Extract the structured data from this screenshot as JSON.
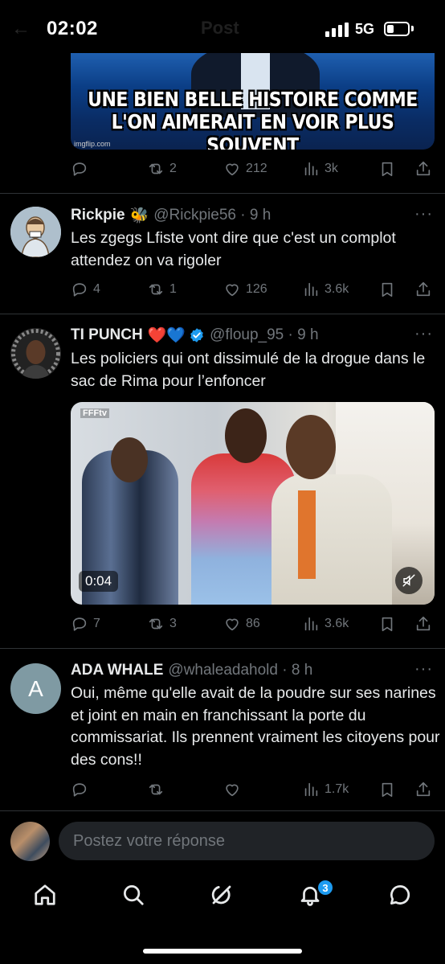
{
  "status_bar": {
    "time": "02:02",
    "network": "5G",
    "header_back": "←",
    "header_title": "Post"
  },
  "tweets": [
    {
      "image_caption_line1": "UNE BIEN BELLE HISTOIRE COMME",
      "image_caption_line2": "L'ON AIMERAIT EN VOIR PLUS SOUVENT",
      "image_watermark": "imgflip.com",
      "stats": {
        "replies": "",
        "reposts": "2",
        "likes": "212",
        "views": "3k"
      }
    },
    {
      "name": "Rickpie",
      "emoji": "🐝",
      "handle": "@Rickpie56 · 9 h",
      "text": "Les zgegs Lfiste vont dire que c'est un complot attendez on va rigoler",
      "stats": {
        "replies": "4",
        "reposts": "1",
        "likes": "126",
        "views": "3.6k"
      }
    },
    {
      "name": "TI PUNCH",
      "emoji": "❤️💙",
      "handle": "@floup_95 · 9 h",
      "text": "Les policiers qui ont dissimulé de la drogue dans le sac de Rima pour l’enfoncer",
      "video": {
        "channel_logo": "FFFtv",
        "duration": "0:04"
      },
      "stats": {
        "replies": "7",
        "reposts": "3",
        "likes": "86",
        "views": "3.6k"
      }
    },
    {
      "name": "ADA WHALE",
      "handle": "@whaleadahold · 8 h",
      "avatar_letter": "A",
      "text": "Oui, même qu'elle avait de la poudre sur ses narines et joint en main en franchissant la porte du commissariat. Ils prennent vraiment les citoyens pour des cons!!",
      "stats": {
        "replies": "",
        "reposts": "",
        "likes": "",
        "views": "1.7k"
      }
    }
  ],
  "reply": {
    "placeholder": "Postez votre réponse"
  },
  "nav": {
    "notifications_badge": "3"
  },
  "colors": {
    "background": "#000000",
    "text": "#e7e9ea",
    "muted": "#71767b",
    "accent": "#1d9bf0",
    "verified": "#1d9bf0",
    "input_bg": "#202327"
  },
  "icons": [
    "reply-icon",
    "repost-icon",
    "like-icon",
    "views-icon",
    "bookmark-icon",
    "share-icon",
    "more-icon",
    "verified-icon",
    "mute-icon",
    "home-icon",
    "search-icon",
    "grok-icon",
    "bell-icon",
    "messages-icon"
  ]
}
